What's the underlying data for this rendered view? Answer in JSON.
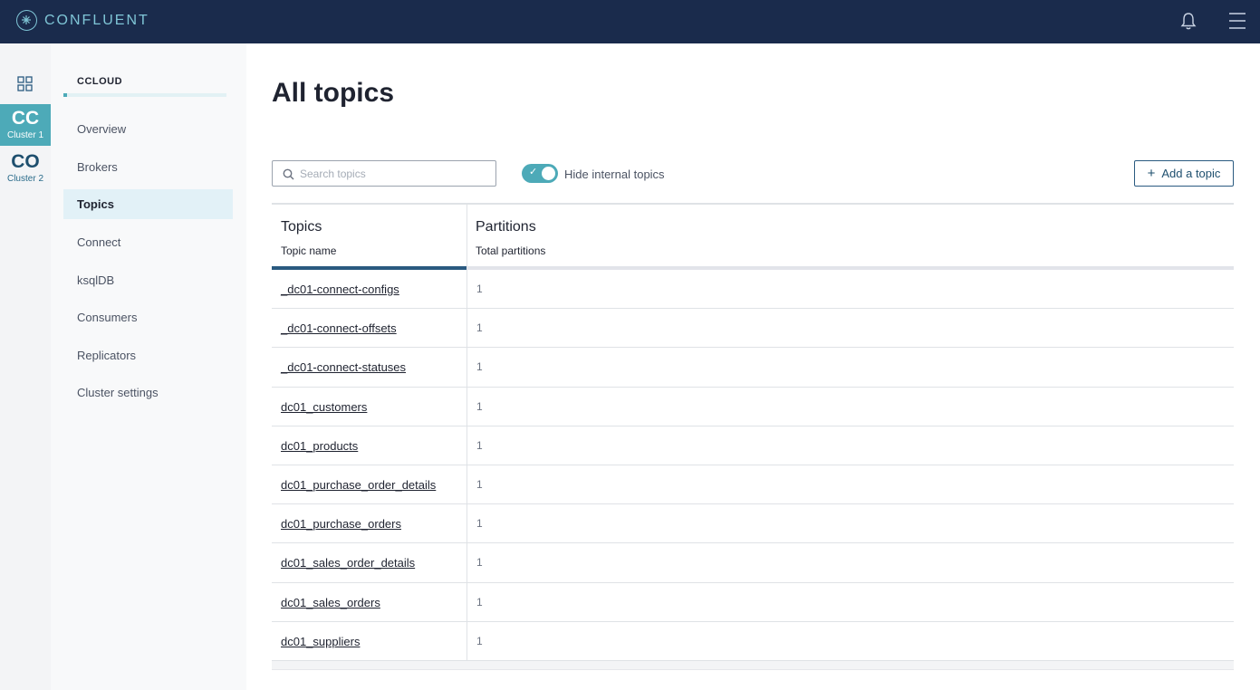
{
  "header": {
    "brand": "CONFLUENT",
    "icons": [
      "confluent-logo-icon",
      "bell-icon",
      "hamburger-menu-icon"
    ]
  },
  "clusters": [
    {
      "abbr": "CC",
      "name": "Cluster 1",
      "active": true
    },
    {
      "abbr": "CO",
      "name": "Cluster 2",
      "active": false
    }
  ],
  "subnav": {
    "title": "CCLOUD",
    "items": [
      {
        "label": "Overview"
      },
      {
        "label": "Brokers"
      },
      {
        "label": "Topics",
        "active": true
      },
      {
        "label": "Connect"
      },
      {
        "label": "ksqlDB"
      },
      {
        "label": "Consumers"
      },
      {
        "label": "Replicators"
      },
      {
        "label": "Cluster settings"
      }
    ]
  },
  "main": {
    "title": "All topics",
    "search": {
      "placeholder": "Search topics",
      "value": ""
    },
    "toggle": {
      "label": "Hide internal topics",
      "on": true
    },
    "add_button": "Add a topic"
  },
  "table": {
    "columns": [
      {
        "title": "Topics",
        "subtitle": "Topic name"
      },
      {
        "title": "Partitions",
        "subtitle": "Total partitions"
      }
    ],
    "rows": [
      {
        "topic": "_dc01-connect-configs",
        "partitions": "1"
      },
      {
        "topic": "_dc01-connect-offsets",
        "partitions": "1"
      },
      {
        "topic": "_dc01-connect-statuses",
        "partitions": "1"
      },
      {
        "topic": "dc01_customers",
        "partitions": "1"
      },
      {
        "topic": "dc01_products",
        "partitions": "1"
      },
      {
        "topic": "dc01_purchase_order_details",
        "partitions": "1"
      },
      {
        "topic": "dc01_purchase_orders",
        "partitions": "1"
      },
      {
        "topic": "dc01_sales_order_details",
        "partitions": "1"
      },
      {
        "topic": "dc01_sales_orders",
        "partitions": "1"
      },
      {
        "topic": "dc01_suppliers",
        "partitions": "1"
      }
    ]
  },
  "colors": {
    "topbar": "#1a2b4c",
    "accent": "#4daab8",
    "brand_text": "#7fc5d6",
    "primary_dark": "#2a5a80"
  }
}
